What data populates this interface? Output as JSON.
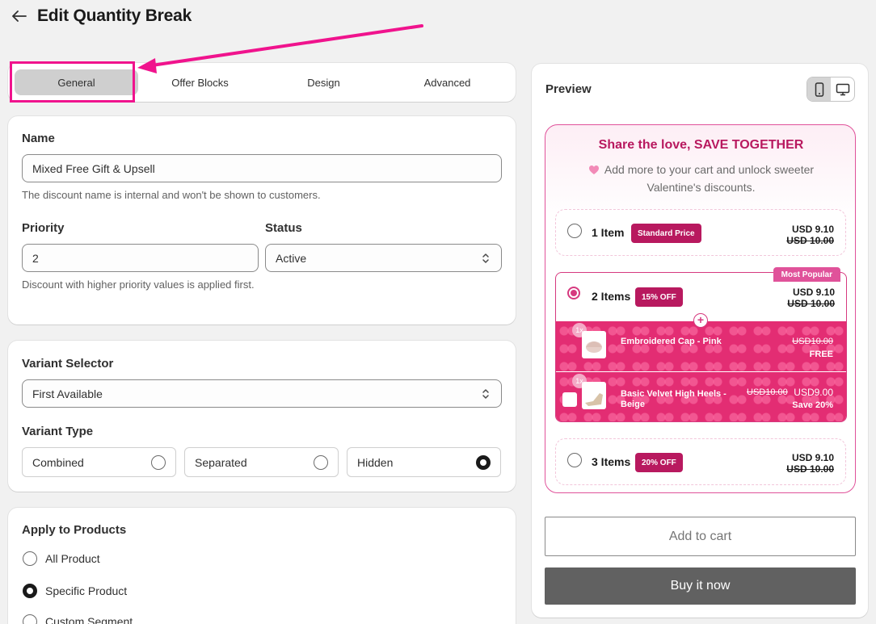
{
  "header": {
    "title": "Edit Quantity Break"
  },
  "tabs": [
    {
      "label": "General"
    },
    {
      "label": "Offer Blocks"
    },
    {
      "label": "Design"
    },
    {
      "label": "Advanced"
    }
  ],
  "general": {
    "name_label": "Name",
    "name_value": "Mixed Free Gift & Upsell",
    "name_help": "The discount name is internal and won't be shown to customers.",
    "priority_label": "Priority",
    "priority_value": "2",
    "priority_help": "Discount with higher priority values is applied first.",
    "status_label": "Status",
    "status_value": "Active"
  },
  "variant": {
    "selector_label": "Variant Selector",
    "selector_value": "First Available",
    "type_label": "Variant Type",
    "options": [
      {
        "label": "Combined",
        "selected": false
      },
      {
        "label": "Separated",
        "selected": false
      },
      {
        "label": "Hidden",
        "selected": true
      }
    ]
  },
  "apply": {
    "label": "Apply to Products",
    "options": [
      {
        "label": "All Product",
        "selected": false
      },
      {
        "label": "Specific Product",
        "selected": true
      },
      {
        "label": "Custom Segment",
        "selected": false
      }
    ]
  },
  "preview": {
    "title": "Preview",
    "widget_title": "Share the love, SAVE TOGETHER",
    "widget_subtitle": "Add more to your cart and unlock sweeter Valentine's discounts.",
    "tiers": [
      {
        "label": "1 Item",
        "badge": "Standard Price",
        "price": "USD 9.10",
        "compare": "USD 10.00"
      },
      {
        "label": "2 Items",
        "badge": "15% OFF",
        "price": "USD 9.10",
        "compare": "USD 10.00",
        "popular": "Most Popular"
      },
      {
        "label": "3 Items",
        "badge": "20% OFF",
        "price": "USD 9.10",
        "compare": "USD 10.00"
      }
    ],
    "gifts": [
      {
        "name": "Embroidered Cap - Pink",
        "compare": "USD10.00",
        "note": "FREE",
        "badge": "1x"
      },
      {
        "name": "Basic Velvet High Heels - Beige",
        "compare": "USD10.00",
        "price": "USD9.00",
        "note": "Save 20%",
        "badge": "1x"
      }
    ],
    "add_to_cart": "Add to cart",
    "buy_now": "Buy it now"
  },
  "colors": {
    "accent_pink": "#b8195f",
    "annotation": "#f0138d",
    "gift_bg": "#e32d73"
  }
}
